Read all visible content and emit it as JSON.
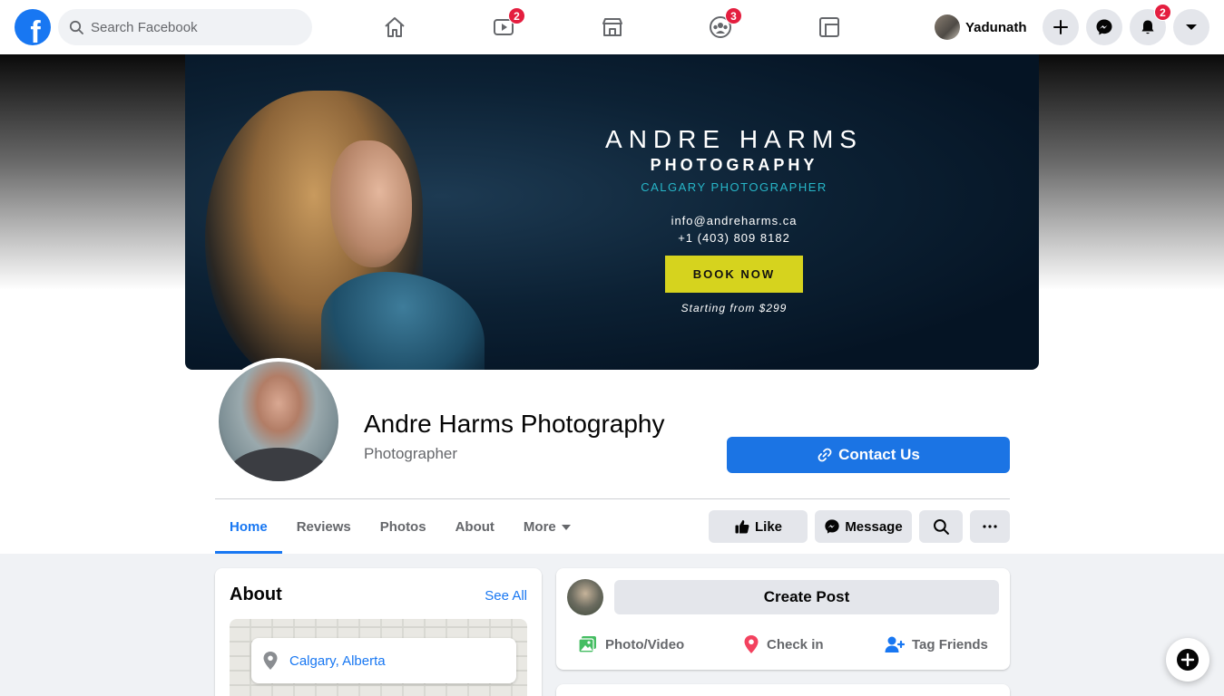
{
  "nav": {
    "search_placeholder": "Search Facebook",
    "watch_badge": "2",
    "groups_badge": "3",
    "user_name": "Yadunath",
    "notifications_badge": "2",
    "icons": [
      "home-icon",
      "watch-icon",
      "marketplace-icon",
      "groups-icon",
      "gaming-icon",
      "plus-icon",
      "messenger-icon",
      "bell-icon",
      "caret-down-icon"
    ]
  },
  "cover": {
    "title": "ANDRE HARMS",
    "subtitle": "PHOTOGRAPHY",
    "tagline": "CALGARY PHOTOGRAPHER",
    "email": "info@andreharms.ca",
    "phone": "+1 (403) 809 8182",
    "cta": "BOOK NOW",
    "price": "Starting from $299"
  },
  "page": {
    "name": "Andre Harms Photography",
    "category": "Photographer",
    "contact_label": "Contact Us"
  },
  "tabs": [
    {
      "label": "Home",
      "active": true
    },
    {
      "label": "Reviews"
    },
    {
      "label": "Photos"
    },
    {
      "label": "About"
    },
    {
      "label": "More"
    }
  ],
  "actions": {
    "like": "Like",
    "message": "Message"
  },
  "about": {
    "title": "About",
    "see_all": "See All",
    "location": "Calgary, Alberta"
  },
  "create_post": {
    "label": "Create Post",
    "photo_video": "Photo/Video",
    "check_in": "Check in",
    "tag_friends": "Tag Friends"
  },
  "colors": {
    "brand": "#1877f2",
    "badge": "#e41e3f",
    "book_button": "#d6d31e",
    "tagline": "#27b6c8"
  }
}
